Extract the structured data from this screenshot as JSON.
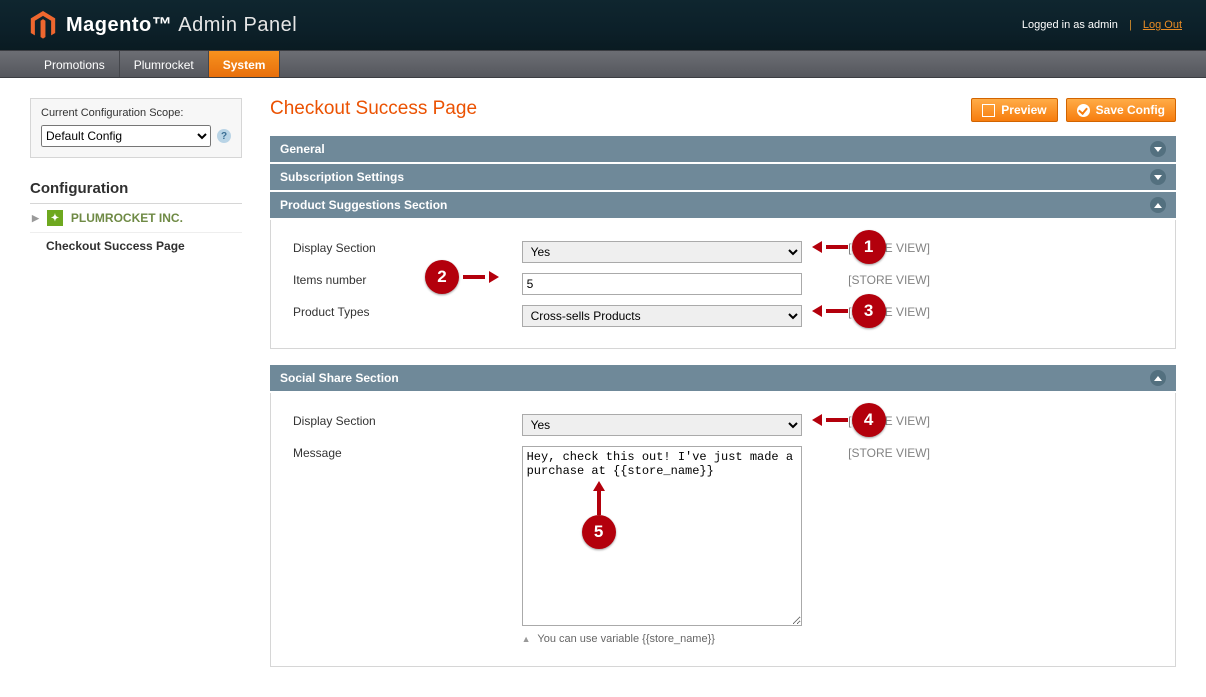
{
  "header": {
    "brand_main": "Magento",
    "brand_sub": "Admin Panel",
    "logged_text": "Logged in as admin",
    "logout_text": "Log Out"
  },
  "nav": {
    "items": [
      "Promotions",
      "Plumrocket",
      "System"
    ],
    "active_index": 2
  },
  "sidebar": {
    "scope_label": "Current Configuration Scope:",
    "scope_value": "Default Config",
    "config_header": "Configuration",
    "vendor_label": "PLUMROCKET INC.",
    "sub_page": "Checkout Success Page"
  },
  "page_title": "Checkout Success Page",
  "buttons": {
    "preview": "Preview",
    "save": "Save Config"
  },
  "sections": {
    "general": {
      "title": "General"
    },
    "subscription": {
      "title": "Subscription Settings"
    },
    "product_suggestions": {
      "title": "Product Suggestions Section",
      "fields": {
        "display_label": "Display Section",
        "display_value": "Yes",
        "items_label": "Items number",
        "items_value": "5",
        "types_label": "Product Types",
        "types_value": "Cross-sells Products",
        "scope": "[STORE VIEW]"
      }
    },
    "social_share": {
      "title": "Social Share Section",
      "fields": {
        "display_label": "Display Section",
        "display_value": "Yes",
        "message_label": "Message",
        "message_value": "Hey, check this out! I've just made a purchase at {{store_name}}",
        "scope": "[STORE VIEW]",
        "note": "You can use variable {{store_name}}"
      }
    }
  },
  "callouts": {
    "1": "1",
    "2": "2",
    "3": "3",
    "4": "4",
    "5": "5"
  }
}
